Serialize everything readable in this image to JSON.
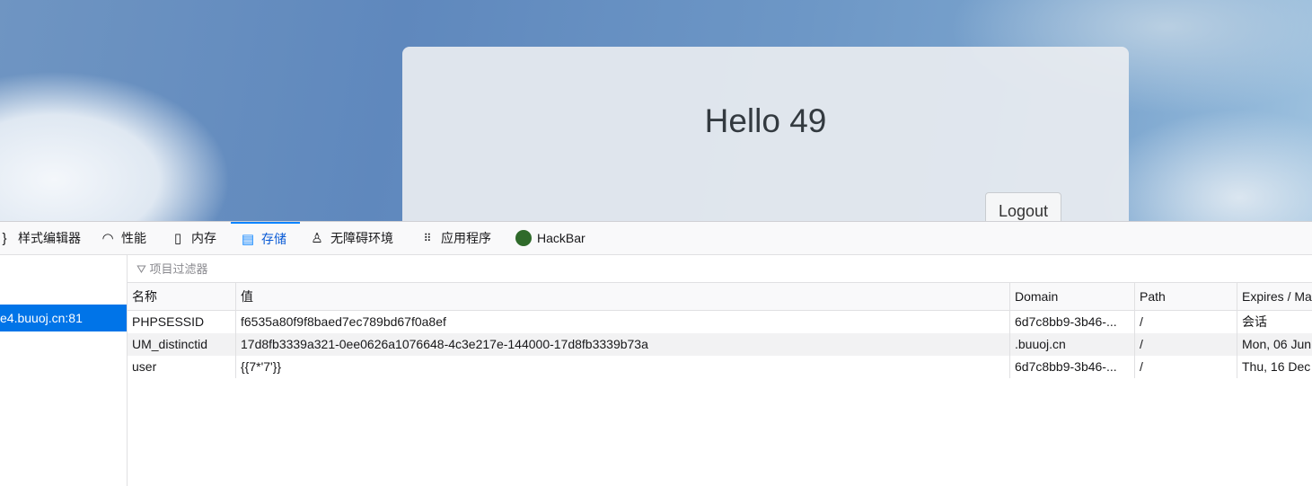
{
  "page": {
    "greeting": "Hello 49",
    "logout_label": "Logout"
  },
  "devtools": {
    "tabs": [
      {
        "icon": "style-editor-icon",
        "label": "样式编辑器"
      },
      {
        "icon": "performance-icon",
        "label": "性能"
      },
      {
        "icon": "memory-icon",
        "label": "内存"
      },
      {
        "icon": "storage-icon",
        "label": "存储",
        "selected": true
      },
      {
        "icon": "accessibility-icon",
        "label": "无障碍环境"
      },
      {
        "icon": "application-icon",
        "label": "应用程序"
      },
      {
        "icon": "hackbar-icon",
        "label": "HackBar"
      }
    ],
    "host": "e4.buuoj.cn:81",
    "filter_placeholder": "项目过滤器",
    "columns": [
      "名称",
      "值",
      "Domain",
      "Path",
      "Expires / Ma"
    ],
    "rows": [
      [
        "PHPSESSID",
        "f6535a80f9f8baed7ec789bd67f0a8ef",
        "6d7c8bb9-3b46-...",
        "/",
        "会话"
      ],
      [
        "UM_distinctid",
        "17d8fb3339a321-0ee0626a1076648-4c3e217e-144000-17d8fb3339b73a",
        ".buuoj.cn",
        "/",
        "Mon, 06 Jun"
      ],
      [
        "user",
        "{{7*'7'}}",
        "6d7c8bb9-3b46-...",
        "/",
        "Thu, 16 Dec"
      ]
    ],
    "colors": {
      "accent": "#0a84ff",
      "selected_bg": "#0074e8"
    }
  }
}
